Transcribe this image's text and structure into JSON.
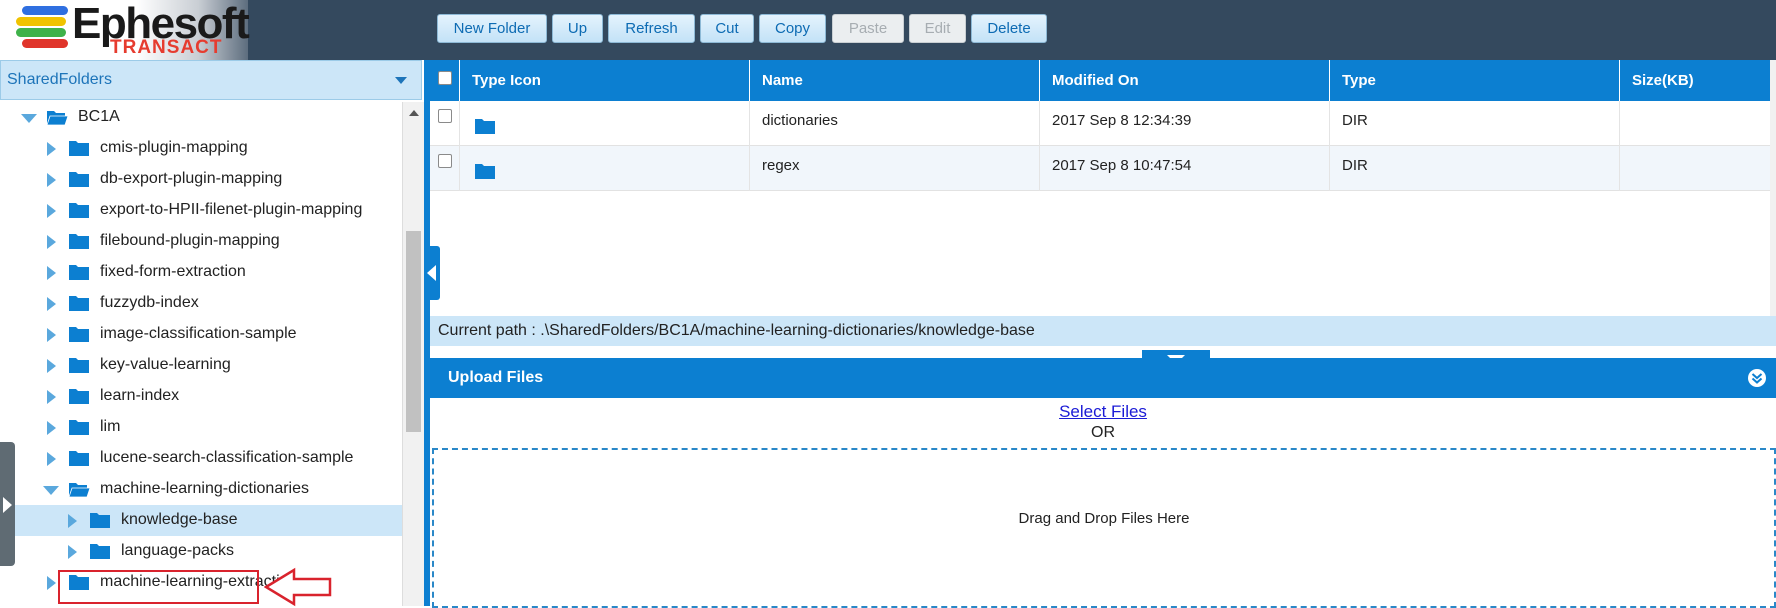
{
  "brand": {
    "name": "Ephesoft",
    "sub": "TRANSACT",
    "bar_colors": [
      "#2f6fe0",
      "#f0c300",
      "#3fb24a",
      "#e0352b"
    ]
  },
  "toolbar": {
    "new_folder": "New Folder",
    "up": "Up",
    "refresh": "Refresh",
    "cut": "Cut",
    "copy": "Copy",
    "paste": "Paste",
    "edit": "Edit",
    "delete": "Delete"
  },
  "sidebar": {
    "selected_root": "SharedFolders",
    "tree": [
      {
        "label": "BC1A",
        "level": 0,
        "state": "expanded"
      },
      {
        "label": "cmis-plugin-mapping",
        "level": 1,
        "state": "collapsed"
      },
      {
        "label": "db-export-plugin-mapping",
        "level": 1,
        "state": "collapsed"
      },
      {
        "label": "export-to-HPII-filenet-plugin-mapping",
        "level": 1,
        "state": "collapsed"
      },
      {
        "label": "filebound-plugin-mapping",
        "level": 1,
        "state": "collapsed"
      },
      {
        "label": "fixed-form-extraction",
        "level": 1,
        "state": "collapsed"
      },
      {
        "label": "fuzzydb-index",
        "level": 1,
        "state": "collapsed"
      },
      {
        "label": "image-classification-sample",
        "level": 1,
        "state": "collapsed"
      },
      {
        "label": "key-value-learning",
        "level": 1,
        "state": "collapsed"
      },
      {
        "label": "learn-index",
        "level": 1,
        "state": "collapsed"
      },
      {
        "label": "lim",
        "level": 1,
        "state": "collapsed"
      },
      {
        "label": "lucene-search-classification-sample",
        "level": 1,
        "state": "collapsed"
      },
      {
        "label": "machine-learning-dictionaries",
        "level": 1,
        "state": "expanded"
      },
      {
        "label": "knowledge-base",
        "level": 2,
        "state": "collapsed",
        "selected": true
      },
      {
        "label": "language-packs",
        "level": 2,
        "state": "collapsed"
      },
      {
        "label": "machine-learning-extraction",
        "level": 1,
        "state": "collapsed"
      }
    ]
  },
  "grid": {
    "columns": [
      "Type Icon",
      "Name",
      "Modified On",
      "Type",
      "Size(KB)"
    ],
    "rows": [
      {
        "name": "dictionaries",
        "modified": "2017 Sep 8 12:34:39",
        "type": "DIR",
        "size": ""
      },
      {
        "name": "regex",
        "modified": "2017 Sep 8 10:47:54",
        "type": "DIR",
        "size": ""
      }
    ]
  },
  "path": {
    "current": "Current path : .\\SharedFolders/BC1A/machine-learning-dictionaries/knowledge-base"
  },
  "upload": {
    "title": "Upload Files",
    "select_files": "Select Files",
    "or": "OR",
    "drop_text": "Drag and Drop Files Here"
  },
  "colors": {
    "header_bg": "#34495e",
    "accent": "#0c7fd1",
    "highlight_bg": "#cce6f8",
    "callout": "#d9232d"
  }
}
